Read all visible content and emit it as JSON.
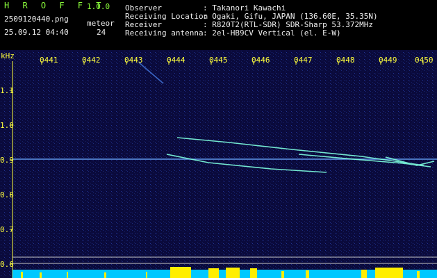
{
  "app": {
    "title": "H R O F F T",
    "version": "1.0.0",
    "file": "2509120440.png",
    "datetime": "25.09.12 04:40",
    "meteor_label": "meteor",
    "meteor_count": "24"
  },
  "info": {
    "rows": [
      {
        "key": "Observer",
        "value": ": Takanori Kawachi"
      },
      {
        "key": "Receiving Location",
        "value": ": Ogaki, Gifu, JAPAN (136.60E, 35.35N)"
      },
      {
        "key": "Receiver",
        "value": ": R820T2(RTL-SDR) SDR-Sharp 53.372MHz"
      },
      {
        "key": "Receiving antenna",
        "value": ": 2el-HB9CV Vertical (el. E-W)"
      }
    ]
  },
  "axis": {
    "unit": "kHz",
    "time_ticks": [
      "0441",
      "0442",
      "0443",
      "0444",
      "0445",
      "0446",
      "0447",
      "0448",
      "0449",
      "0450"
    ],
    "freq_ticks": [
      "1.1",
      "1.0",
      "0.9",
      "0.8",
      "0.7",
      "0.6"
    ]
  },
  "colors": {
    "background": "#0a0a3c",
    "carrier": "#6aa8ff",
    "trace": "#7fffe0",
    "amplitude": "#ffee00",
    "baseline": "#00c8ff",
    "header_green": "#8cff3c",
    "tick_yellow": "#ffff3c"
  }
}
